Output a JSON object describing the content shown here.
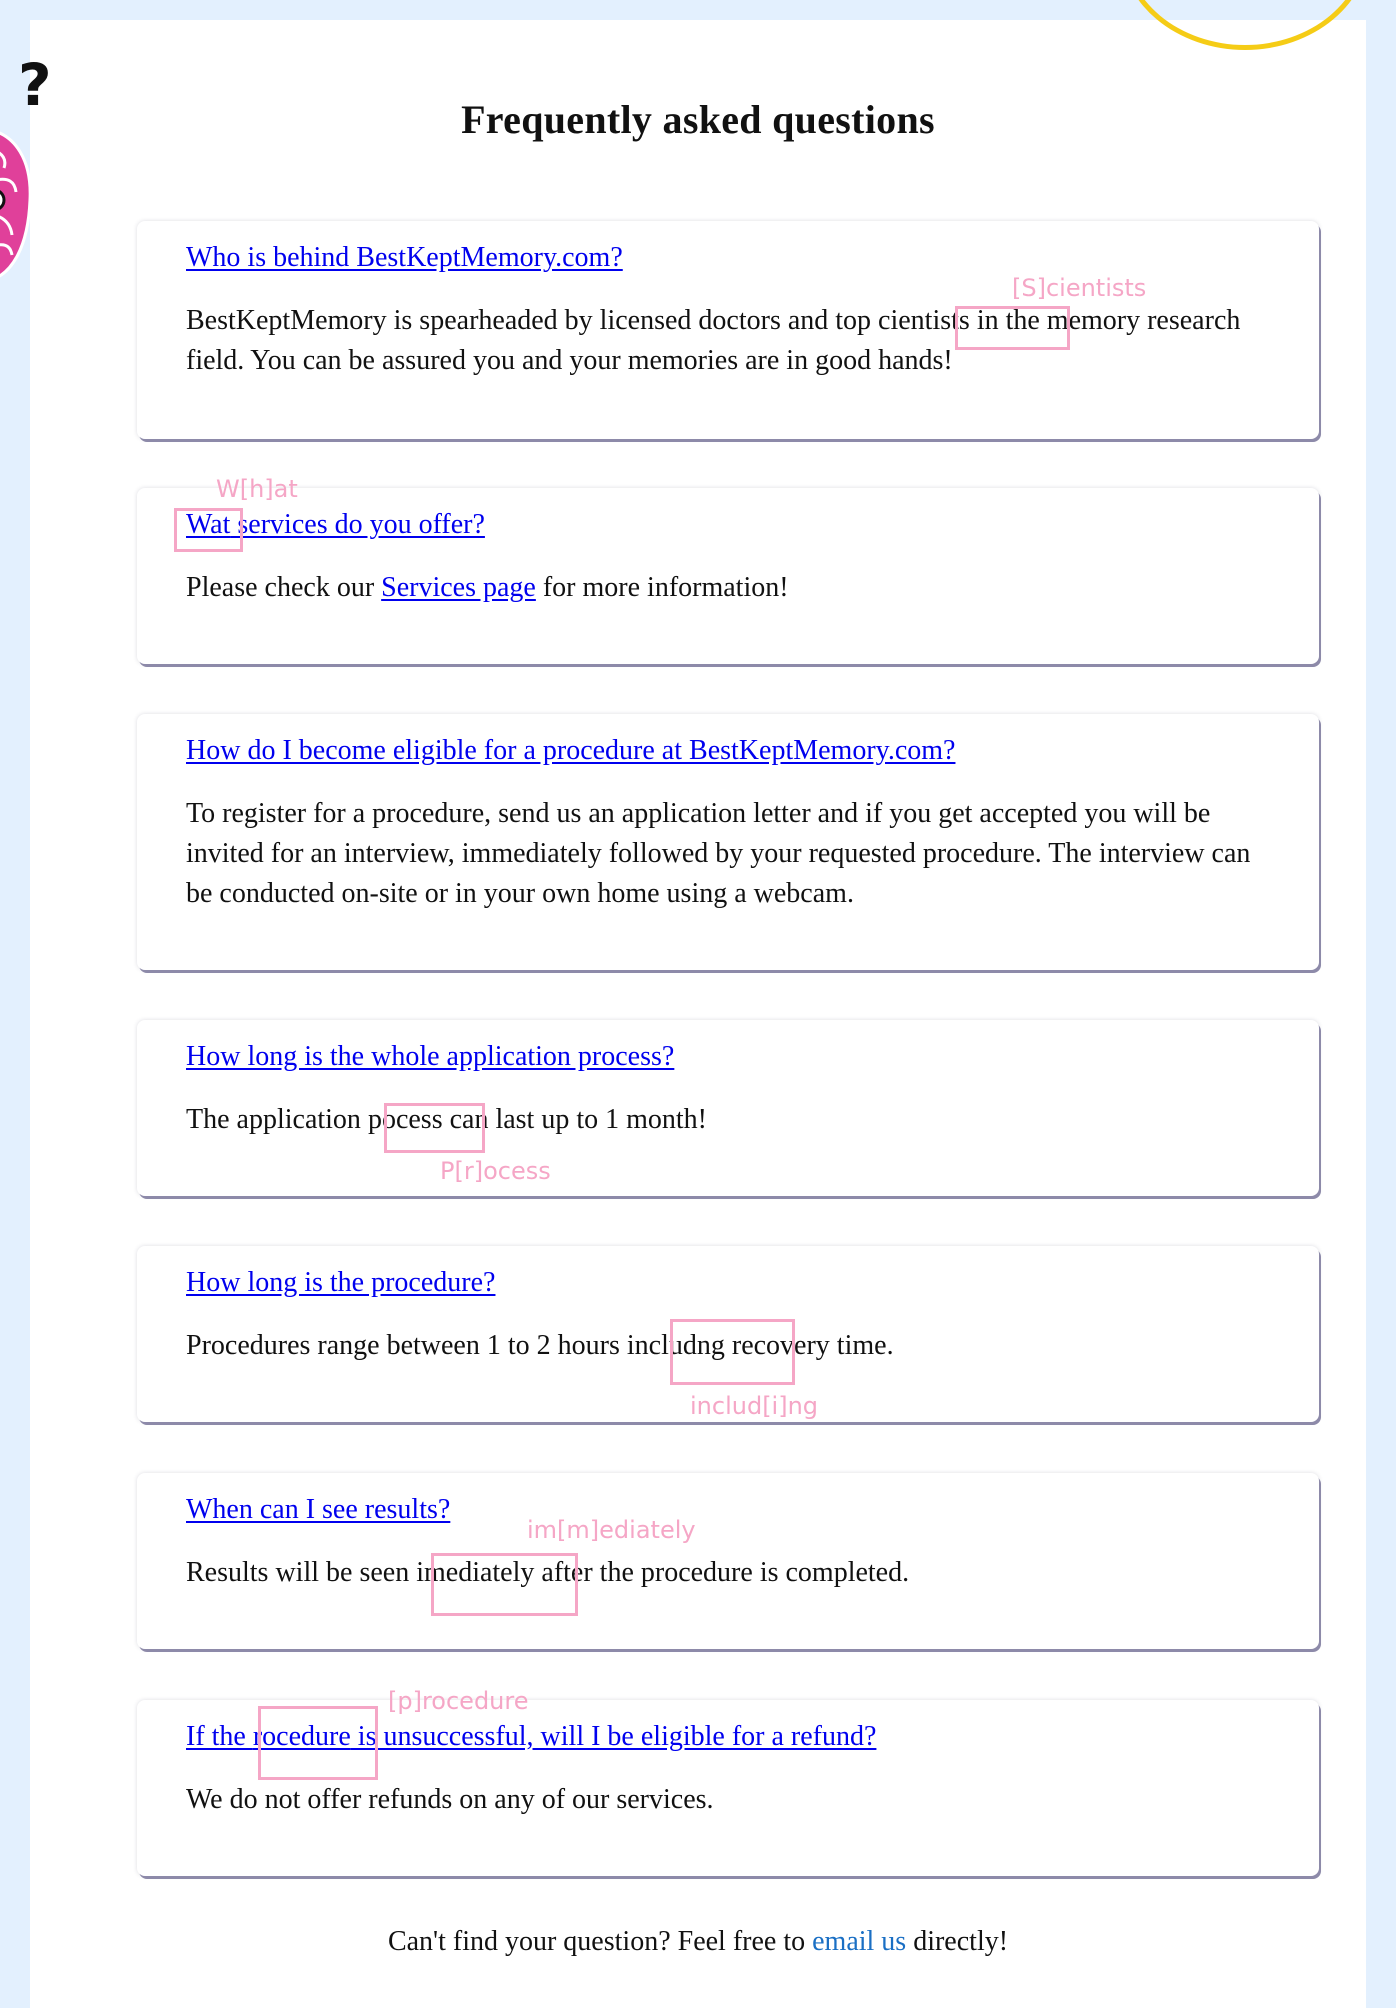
{
  "title": "Frequently asked questions",
  "faq": [
    {
      "question": "Who is behind BestKeptMemory.com?",
      "answer_before": "BestKeptMemory is spearheaded by licensed doctors and top ",
      "answer_error": "cientists",
      "answer_after": " in the memory research field. You can be assured you and your memories are in good hands!",
      "correction": "[S]cientists"
    },
    {
      "question_error": "Wat",
      "question_after": " services do you offer?",
      "answer_before": "Please check our ",
      "answer_link": "Services page",
      "answer_after": " for more information!",
      "correction": "W[h]at"
    },
    {
      "question": "How do I become eligible for a procedure at BestKeptMemory.com?",
      "answer": "To register for a procedure, send us an application letter and if you get accepted you will be invited for an interview, immediately followed by your requested procedure. The interview can be conducted on-site or in your own home using a webcam."
    },
    {
      "question": "How long is the whole application process?",
      "answer_before": "The application ",
      "answer_error": "pocess",
      "answer_after": " can last up to 1 month!",
      "correction": "P[r]ocess"
    },
    {
      "question": "How long is the procedure?",
      "answer_before": "Procedures range between 1 to 2 hours ",
      "answer_error": "includng",
      "answer_after": " recovery time.",
      "correction": "includ[i]ng"
    },
    {
      "question": "When can I see results?",
      "answer_before": "Results will be seen ",
      "answer_error": "imediately",
      "answer_after": " after the procedure is completed.",
      "correction": "im[m]ediately"
    },
    {
      "question_before": "If the ",
      "question_error": "rocedure",
      "question_after": " is unsuccessful, will I be eligible for a refund?",
      "answer": "We do not offer refunds on any of our services.",
      "correction": "[p]rocedure"
    }
  ],
  "footer": {
    "before": "Can't find your question? Feel free to ",
    "link": "email us",
    "after": " directly!"
  },
  "colors": {
    "background": "#e3f0fe",
    "link": "#0000ee",
    "annotation": "#f5a6c6",
    "deco_circle": "#f5cc16",
    "deco_brain": "#e0409a"
  }
}
